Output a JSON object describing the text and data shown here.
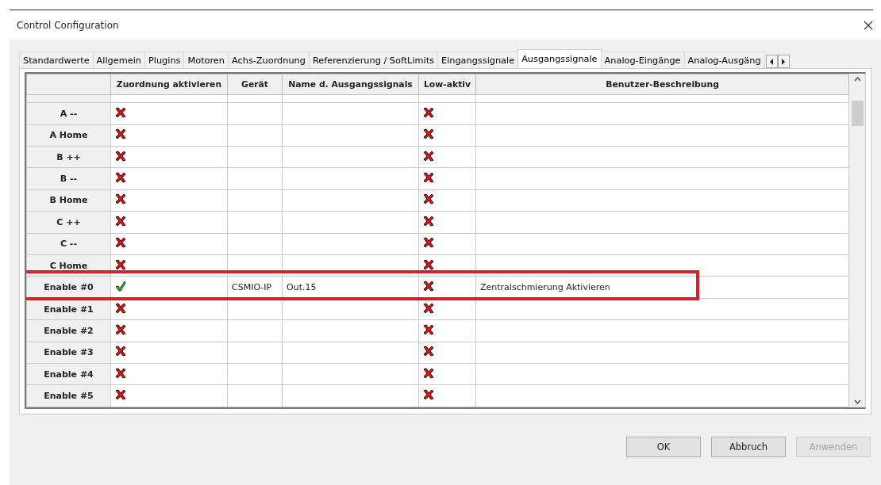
{
  "window": {
    "title": "Control Configuration"
  },
  "tabs": [
    {
      "label": "Standardwerte",
      "selected": false
    },
    {
      "label": "Allgemein",
      "selected": false
    },
    {
      "label": "Plugins",
      "selected": false
    },
    {
      "label": "Motoren",
      "selected": false
    },
    {
      "label": "Achs-Zuordnung",
      "selected": false
    },
    {
      "label": "Referenzierung / SoftLimits",
      "selected": false
    },
    {
      "label": "Eingangssignale",
      "selected": false
    },
    {
      "label": "Ausgangssignale",
      "selected": true
    },
    {
      "label": "Analog-Eingänge",
      "selected": false
    },
    {
      "label": "Analog-Ausgäng",
      "selected": false
    }
  ],
  "table": {
    "columns": [
      "Zuordnung aktivieren",
      "Gerät",
      "Name d. Ausgangssignals",
      "Low-aktiv",
      "Benutzer-Beschreibung"
    ],
    "rows": [
      {
        "label": "A --",
        "enabled": false,
        "low_active": false
      },
      {
        "label": "A Home",
        "enabled": false,
        "low_active": false
      },
      {
        "label": "B ++",
        "enabled": false,
        "low_active": false
      },
      {
        "label": "B --",
        "enabled": false,
        "low_active": false
      },
      {
        "label": "B Home",
        "enabled": false,
        "low_active": false
      },
      {
        "label": "C ++",
        "enabled": false,
        "low_active": false
      },
      {
        "label": "C --",
        "enabled": false,
        "low_active": false
      },
      {
        "label": "C Home",
        "enabled": false,
        "low_active": false
      },
      {
        "label": "Enable #0",
        "enabled": true,
        "device": "CSMIO-IP",
        "signal": "Out.15",
        "low_active": false,
        "description": "Zentralschmierung Aktivieren",
        "highlighted": true
      },
      {
        "label": "Enable #1",
        "enabled": false,
        "low_active": false
      },
      {
        "label": "Enable #2",
        "enabled": false,
        "low_active": false
      },
      {
        "label": "Enable #3",
        "enabled": false,
        "low_active": false
      },
      {
        "label": "Enable #4",
        "enabled": false,
        "low_active": false
      },
      {
        "label": "Enable #5",
        "enabled": false,
        "low_active": false
      }
    ]
  },
  "buttons": [
    {
      "label": "OK",
      "disabled": false
    },
    {
      "label": "Abbruch",
      "disabled": false
    },
    {
      "label": "Anwenden",
      "disabled": true
    }
  ]
}
